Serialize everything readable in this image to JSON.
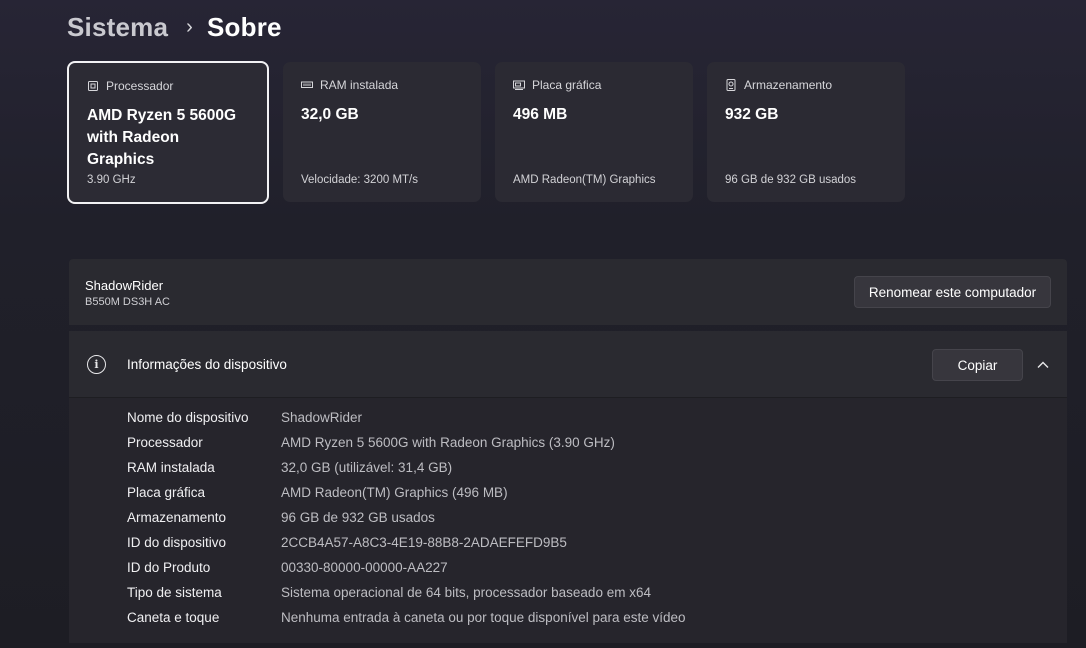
{
  "breadcrumb": {
    "parent": "Sistema",
    "separator": "›",
    "current": "Sobre"
  },
  "cards": [
    {
      "label": "Processador",
      "icon": "processor-icon",
      "value": "AMD Ryzen 5 5600G with Radeon Graphics",
      "sub": "3.90 GHz"
    },
    {
      "label": "RAM instalada",
      "icon": "ram-icon",
      "value": "32,0 GB",
      "sub": "Velocidade: 3200 MT/s"
    },
    {
      "label": "Placa gráfica",
      "icon": "graphics-card-icon",
      "value": "496 MB",
      "sub": "AMD Radeon(TM) Graphics"
    },
    {
      "label": "Armazenamento",
      "icon": "storage-icon",
      "value": "932 GB",
      "sub": "96 GB de 932 GB usados"
    }
  ],
  "computer": {
    "name": "ShadowRider",
    "model": "B550M DS3H AC",
    "rename_label": "Renomear este computador"
  },
  "device_info": {
    "title": "Informações do dispositivo",
    "copy_label": "Copiar",
    "rows": [
      {
        "label": "Nome do dispositivo",
        "value": "ShadowRider"
      },
      {
        "label": "Processador",
        "value": "AMD Ryzen 5 5600G with Radeon Graphics (3.90 GHz)"
      },
      {
        "label": "RAM instalada",
        "value": "32,0 GB (utilizável: 31,4 GB)"
      },
      {
        "label": "Placa gráfica",
        "value": "AMD Radeon(TM) Graphics (496 MB)"
      },
      {
        "label": "Armazenamento",
        "value": "96 GB de 932 GB usados"
      },
      {
        "label": "ID do dispositivo",
        "value": "2CCB4A57-A8C3-4E19-88B8-2ADAEFEFD9B5"
      },
      {
        "label": "ID do Produto",
        "value": "00330-80000-00000-AA227"
      },
      {
        "label": "Tipo de sistema",
        "value": "Sistema operacional de 64 bits, processador baseado em x64"
      },
      {
        "label": "Caneta e toque",
        "value": "Nenhuma entrada à caneta ou por toque disponível para este vídeo"
      }
    ]
  }
}
